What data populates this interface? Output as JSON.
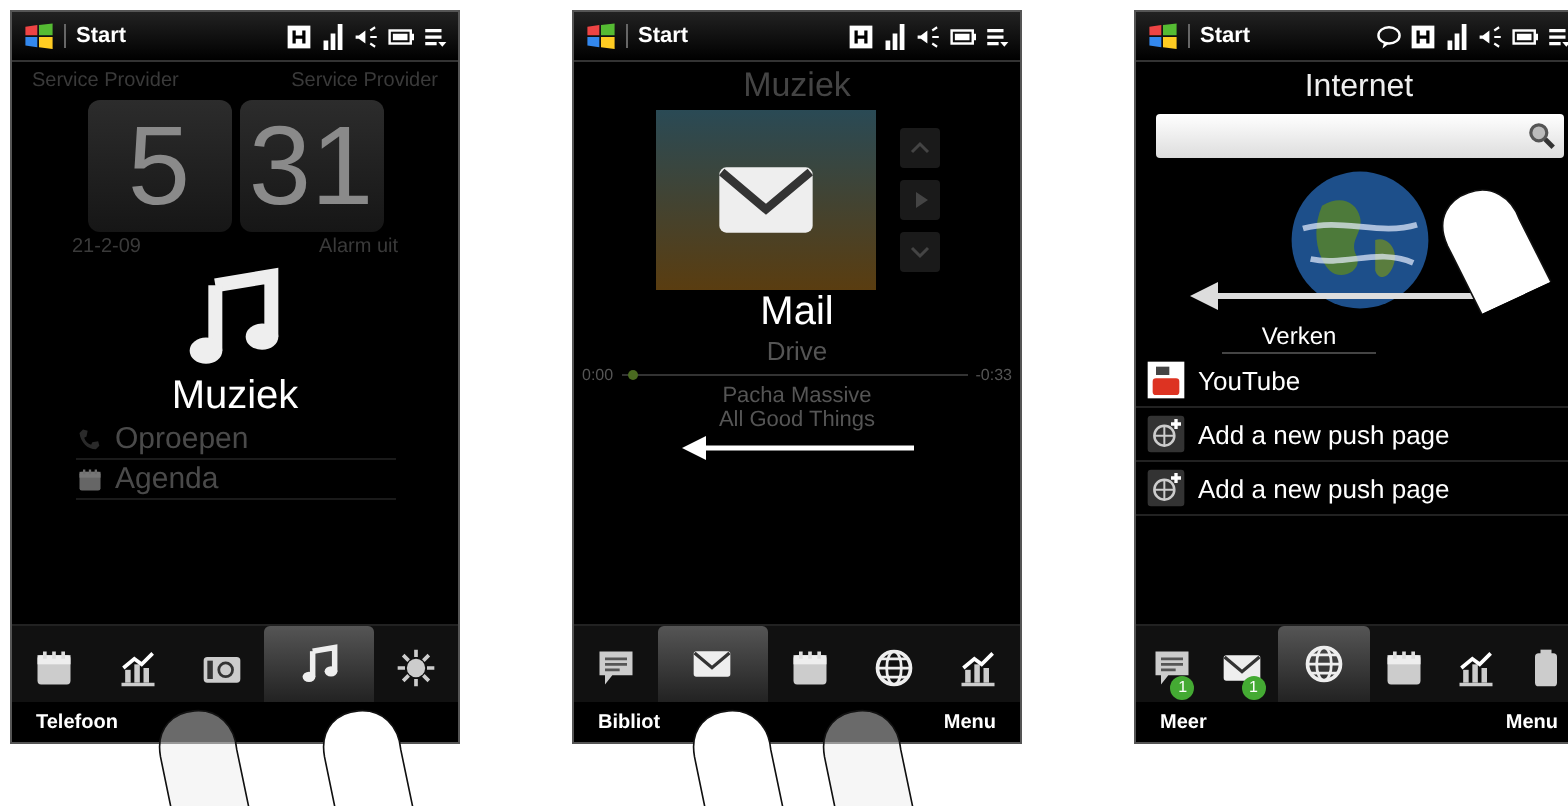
{
  "screens": [
    {
      "kind": "home",
      "start_label": "Start",
      "chat_indicator": false,
      "operators": [
        "Service Provider",
        "Service Provider"
      ],
      "clock": {
        "hours": "5",
        "minutes": "31"
      },
      "date": "21-2-09",
      "alarm": "Alarm uit",
      "rows": [
        {
          "kind": "phone",
          "label": "Oproepen"
        },
        {
          "kind": "calendar",
          "label": "Agenda"
        }
      ],
      "overlay": {
        "kind": "music",
        "label": "Muziek"
      },
      "tabs": [
        {
          "kind": "calendar",
          "selected": false
        },
        {
          "kind": "chart",
          "selected": false
        },
        {
          "kind": "camera",
          "selected": false
        },
        {
          "kind": "music",
          "selected": true
        },
        {
          "kind": "sun",
          "selected": false
        }
      ],
      "softkeys": {
        "left": "Telefoon"
      }
    },
    {
      "kind": "music",
      "start_label": "Start",
      "chat_indicator": false,
      "title": "Muziek",
      "overlay": {
        "kind": "mail",
        "label": "Mail"
      },
      "track": "Drive",
      "elapsed": "0:00",
      "remaining": "-0:33",
      "level": 0.02,
      "artist": "Pacha Massive",
      "album": "All Good Things",
      "tabs": [
        {
          "kind": "message",
          "selected": false
        },
        {
          "kind": "mail",
          "selected": true
        },
        {
          "kind": "calendar",
          "selected": false
        },
        {
          "kind": "globe",
          "selected": false
        },
        {
          "kind": "chart",
          "selected": false
        }
      ],
      "softkeys": {
        "left": "Bibliot",
        "right": "Menu"
      }
    },
    {
      "kind": "internet",
      "start_label": "Start",
      "chat_indicator": true,
      "title": "Internet",
      "globe_label": "Verken",
      "links": [
        {
          "kind": "video",
          "label": "YouTube"
        },
        {
          "kind": "add",
          "label": "Add a new push page"
        },
        {
          "kind": "add",
          "label": "Add a new push page"
        }
      ],
      "tabs": [
        {
          "kind": "message",
          "selected": false,
          "badge": "1"
        },
        {
          "kind": "mail",
          "selected": false,
          "badge": "1"
        },
        {
          "kind": "globe",
          "selected": true
        },
        {
          "kind": "calendar",
          "selected": false
        },
        {
          "kind": "chart",
          "selected": false
        },
        {
          "kind": "battery",
          "selected": false
        }
      ],
      "softkeys": {
        "left": "Meer",
        "right": "Menu"
      }
    }
  ]
}
